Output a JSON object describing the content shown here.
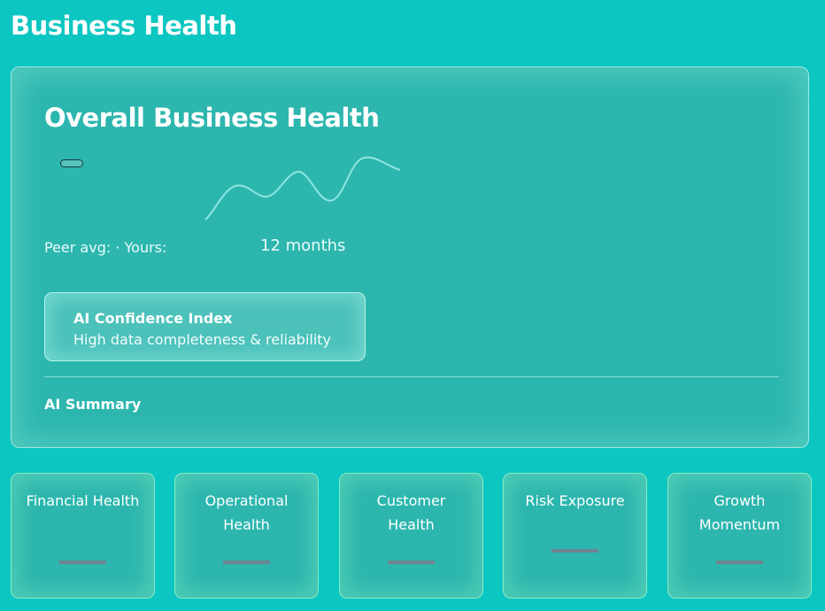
{
  "page": {
    "title": "Business Health"
  },
  "overall": {
    "title": "Overall Business Health",
    "peer_line": "Peer avg: · Yours:",
    "period_label": "12 months"
  },
  "ai_confidence": {
    "title": "AI Confidence Index",
    "subtitle": "High data completeness & reliability"
  },
  "ai_summary": {
    "label": "AI Summary"
  },
  "tiles": [
    {
      "label": "Financial Health",
      "value": "—"
    },
    {
      "label": "Operational Health",
      "value": "—"
    },
    {
      "label": "Customer Health",
      "value": "—"
    },
    {
      "label": "Risk Exposure",
      "value": "—"
    },
    {
      "label": "Growth Momentum",
      "value": "—"
    }
  ],
  "colors": {
    "background": "#0cc6c1",
    "card": "#2cb6ae",
    "sparkline": "#8fe6e0",
    "placeholder_dash": "#6f8491"
  }
}
